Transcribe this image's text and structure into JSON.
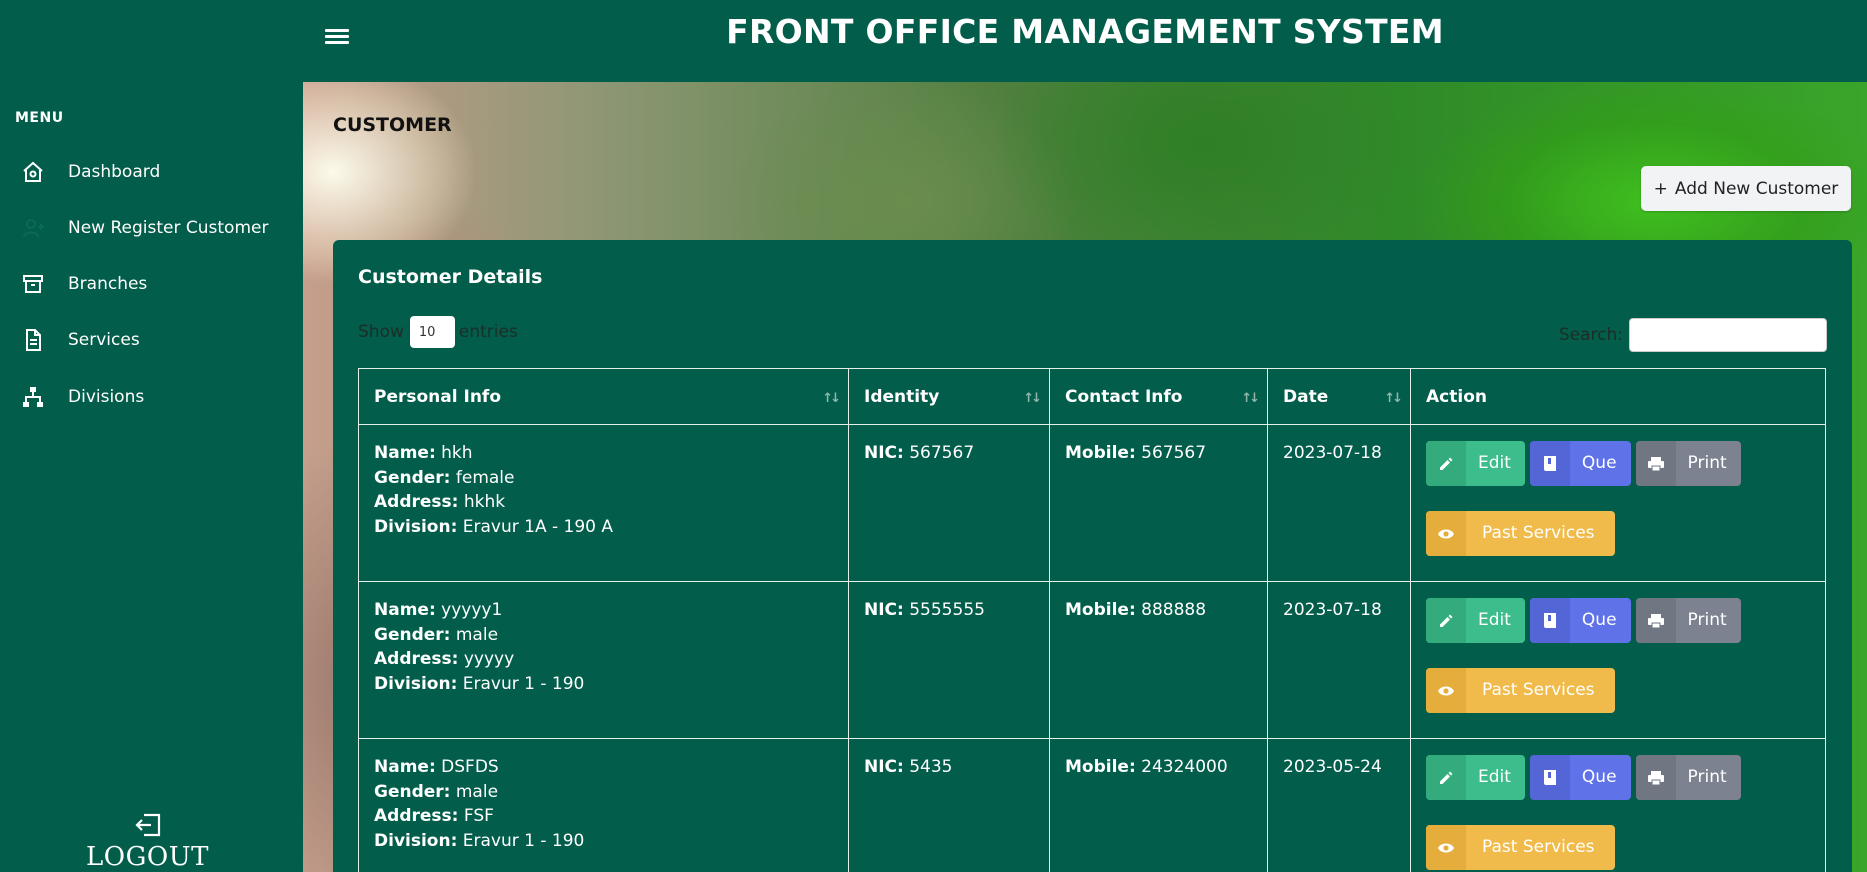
{
  "app": {
    "title": "FRONT OFFICE MANAGEMENT SYSTEM"
  },
  "sidebar": {
    "heading": "MENU",
    "items": [
      {
        "label": "Dashboard",
        "icon": "home-icon"
      },
      {
        "label": "New Register Customer",
        "icon": "user-plus-icon"
      },
      {
        "label": "Branches",
        "icon": "archive-icon"
      },
      {
        "label": "Services",
        "icon": "document-icon"
      },
      {
        "label": "Divisions",
        "icon": "sitemap-icon"
      }
    ],
    "logout_label": "LOGOUT"
  },
  "page": {
    "title": "CUSTOMER",
    "add_button": "Add New Customer"
  },
  "card": {
    "title": "Customer Details",
    "show_label": "Show",
    "entries_value": "10",
    "entries_label": "entries",
    "search_label": "Search:"
  },
  "table": {
    "columns": [
      "Personal Info",
      "Identity",
      "Contact Info",
      "Date",
      "Action"
    ],
    "field_labels": {
      "name": "Name:",
      "gender": "Gender:",
      "address": "Address:",
      "division": "Division:",
      "nic": "NIC:",
      "mobile": "Mobile:"
    },
    "action_labels": {
      "edit": "Edit",
      "que": "Que",
      "print": "Print",
      "past": "Past Services"
    },
    "rows": [
      {
        "name": "hkh",
        "gender": "female",
        "address": "hkhk",
        "division": "Eravur 1A - 190 A",
        "nic": "567567",
        "mobile": "567567",
        "date": "2023-07-18"
      },
      {
        "name": "yyyyy1",
        "gender": "male",
        "address": "yyyyy",
        "division": "Eravur 1 - 190",
        "nic": "5555555",
        "mobile": "888888",
        "date": "2023-07-18"
      },
      {
        "name": "DSFDS",
        "gender": "male",
        "address": "FSF",
        "division": "Eravur 1 - 190",
        "nic": "5435",
        "mobile": "24324000",
        "date": "2023-05-24"
      }
    ]
  }
}
